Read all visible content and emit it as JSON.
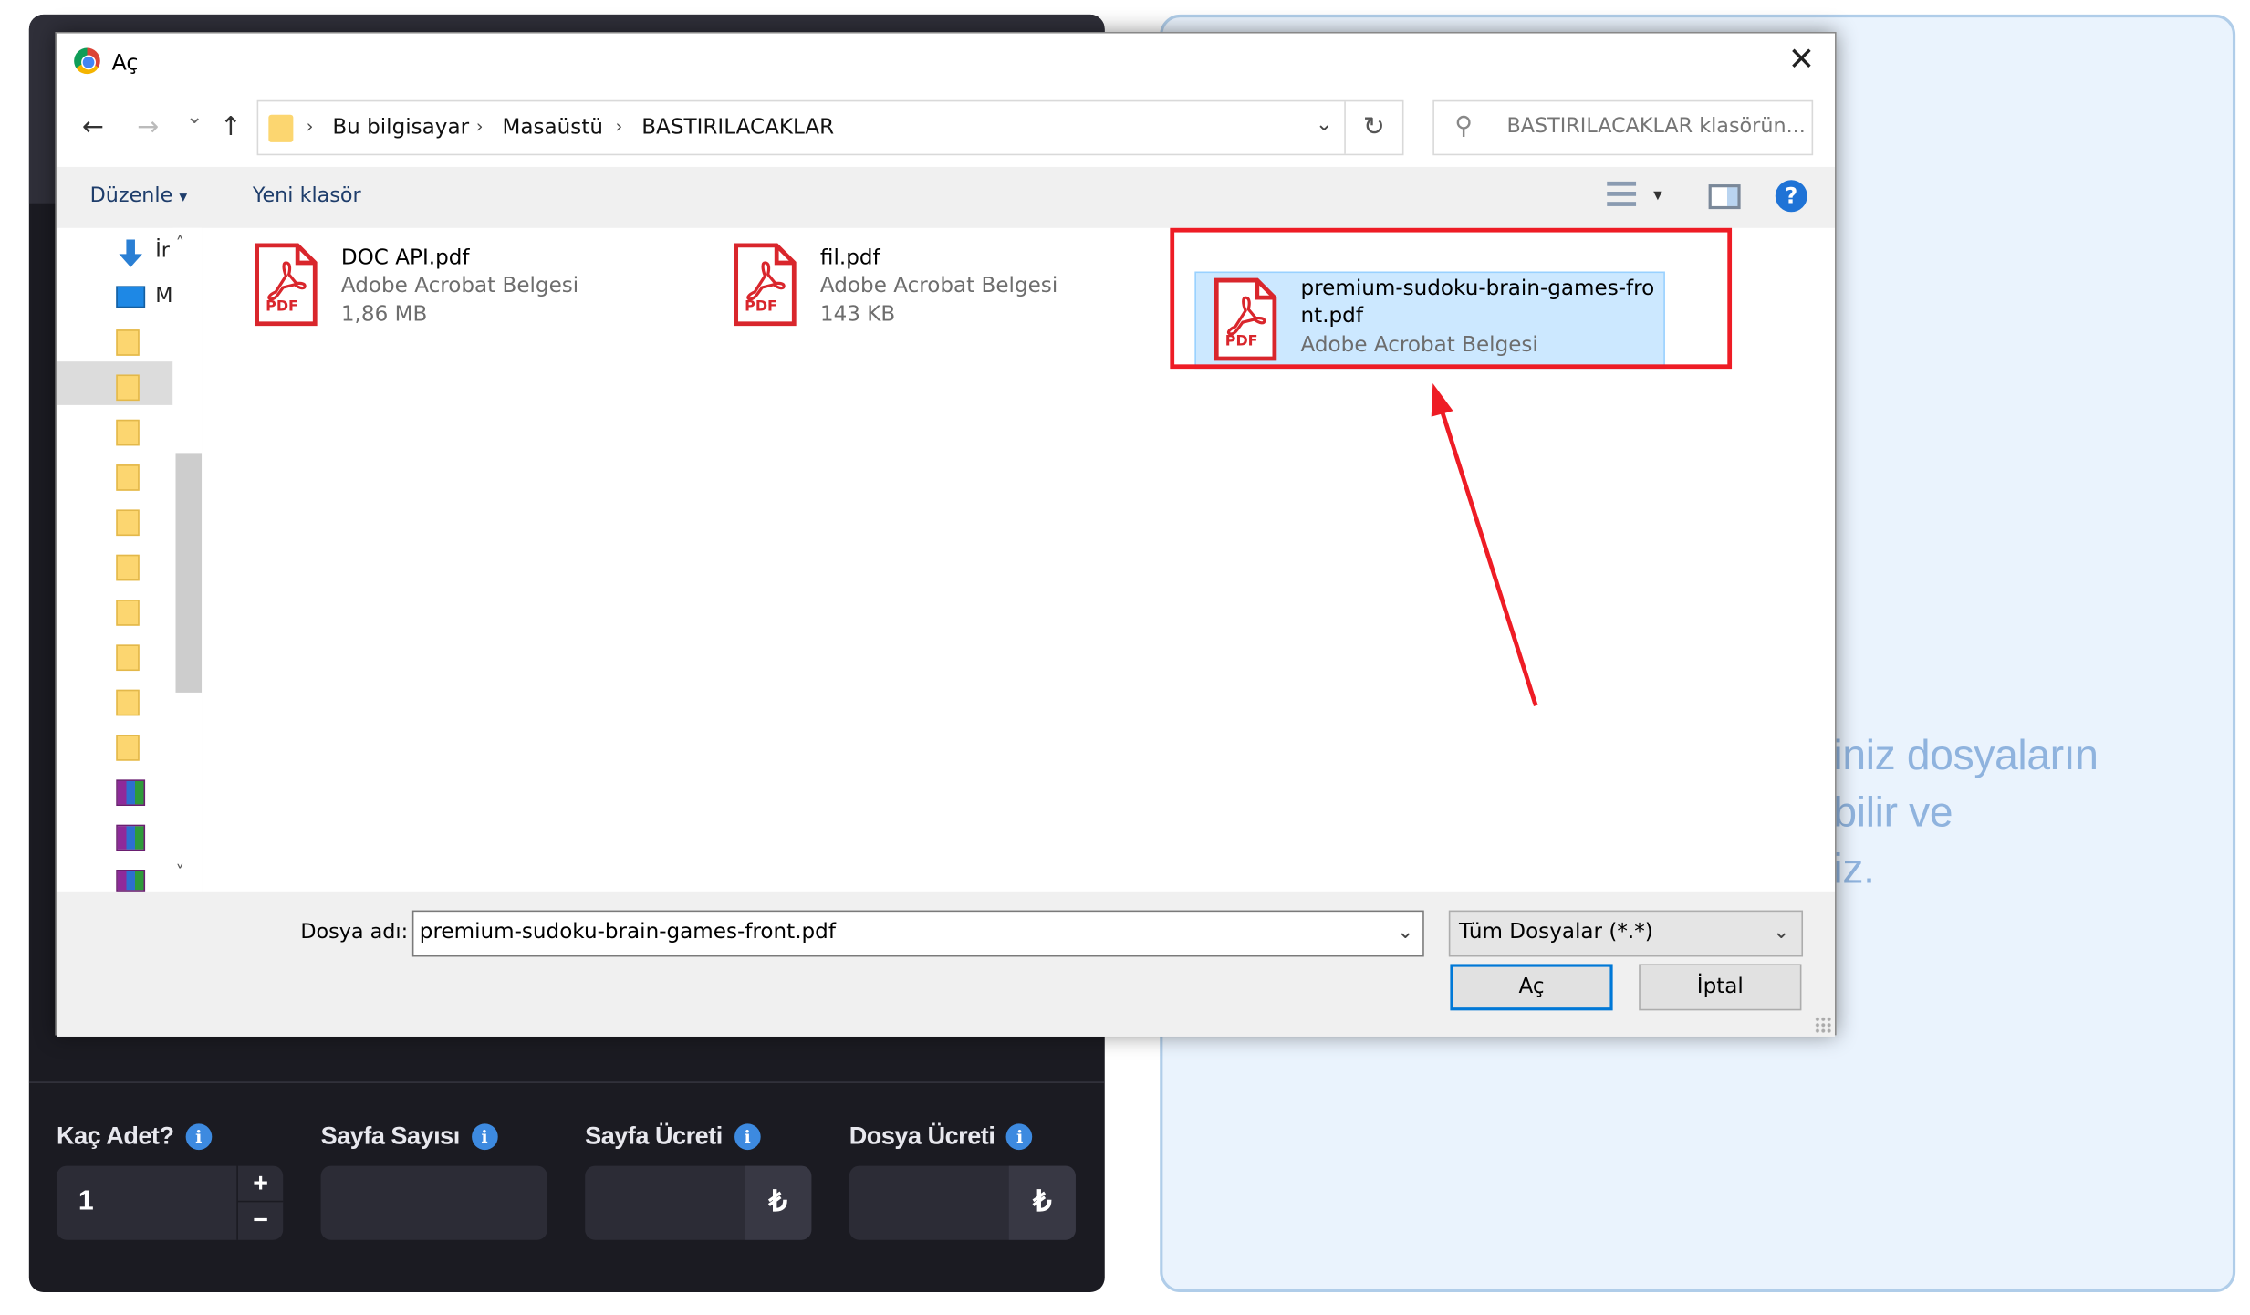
{
  "page": {
    "drop_text_lines": [
      "iniz dosyaların",
      "bilir ve",
      "iz."
    ],
    "fields": [
      {
        "label": "Kaç Adet?",
        "value": "1",
        "plus": "+",
        "minus": "−"
      },
      {
        "label": "Sayfa Sayısı",
        "value": ""
      },
      {
        "label": "Sayfa Ücreti",
        "value": "",
        "currency": "₺"
      },
      {
        "label": "Dosya Ücreti",
        "value": "",
        "currency": "₺"
      }
    ],
    "info_glyph": "i"
  },
  "dialog": {
    "title": "Aç",
    "close": "✕",
    "nav": {
      "back": "←",
      "forward": "→",
      "recent": "⌄",
      "up": "↑"
    },
    "breadcrumb": [
      "Bu bilgisayar",
      "Masaüstü",
      "BASTIRILACAKLAR"
    ],
    "breadcrumb_sep": "›",
    "dropdown_glyph": "⌄",
    "refresh": "↻",
    "search_placeholder": "BASTIRILACAKLAR klasörün...",
    "search_glyph": "⚲",
    "toolbar": {
      "organize": "Düzenle",
      "organize_caret": "▾",
      "new_folder": "Yeni klasör",
      "view_caret": "▾",
      "help": "?"
    },
    "tree_labels": [
      "İr",
      "M"
    ],
    "scroll": {
      "up": "˄",
      "down": "˅"
    },
    "files": [
      {
        "name": "DOC API.pdf",
        "type": "Adobe Acrobat Belgesi",
        "size": "1,86 MB"
      },
      {
        "name": "fil.pdf",
        "type": "Adobe Acrobat Belgesi",
        "size": "143 KB"
      },
      {
        "name": "premium-sudoku-brain-games-front.pdf",
        "type": "Adobe Acrobat Belgesi",
        "selected": true
      }
    ],
    "pdf_badge": "PDF",
    "filename_label": "Dosya adı:",
    "filename_value": "premium-sudoku-brain-games-front.pdf",
    "filter_value": "Tüm Dosyalar (*.*)",
    "open_label": "Aç",
    "cancel_label": "İptal"
  },
  "colors": {
    "annotation": "#ee1c25",
    "selection": "#cce8ff",
    "info": "#3d8ae0"
  }
}
